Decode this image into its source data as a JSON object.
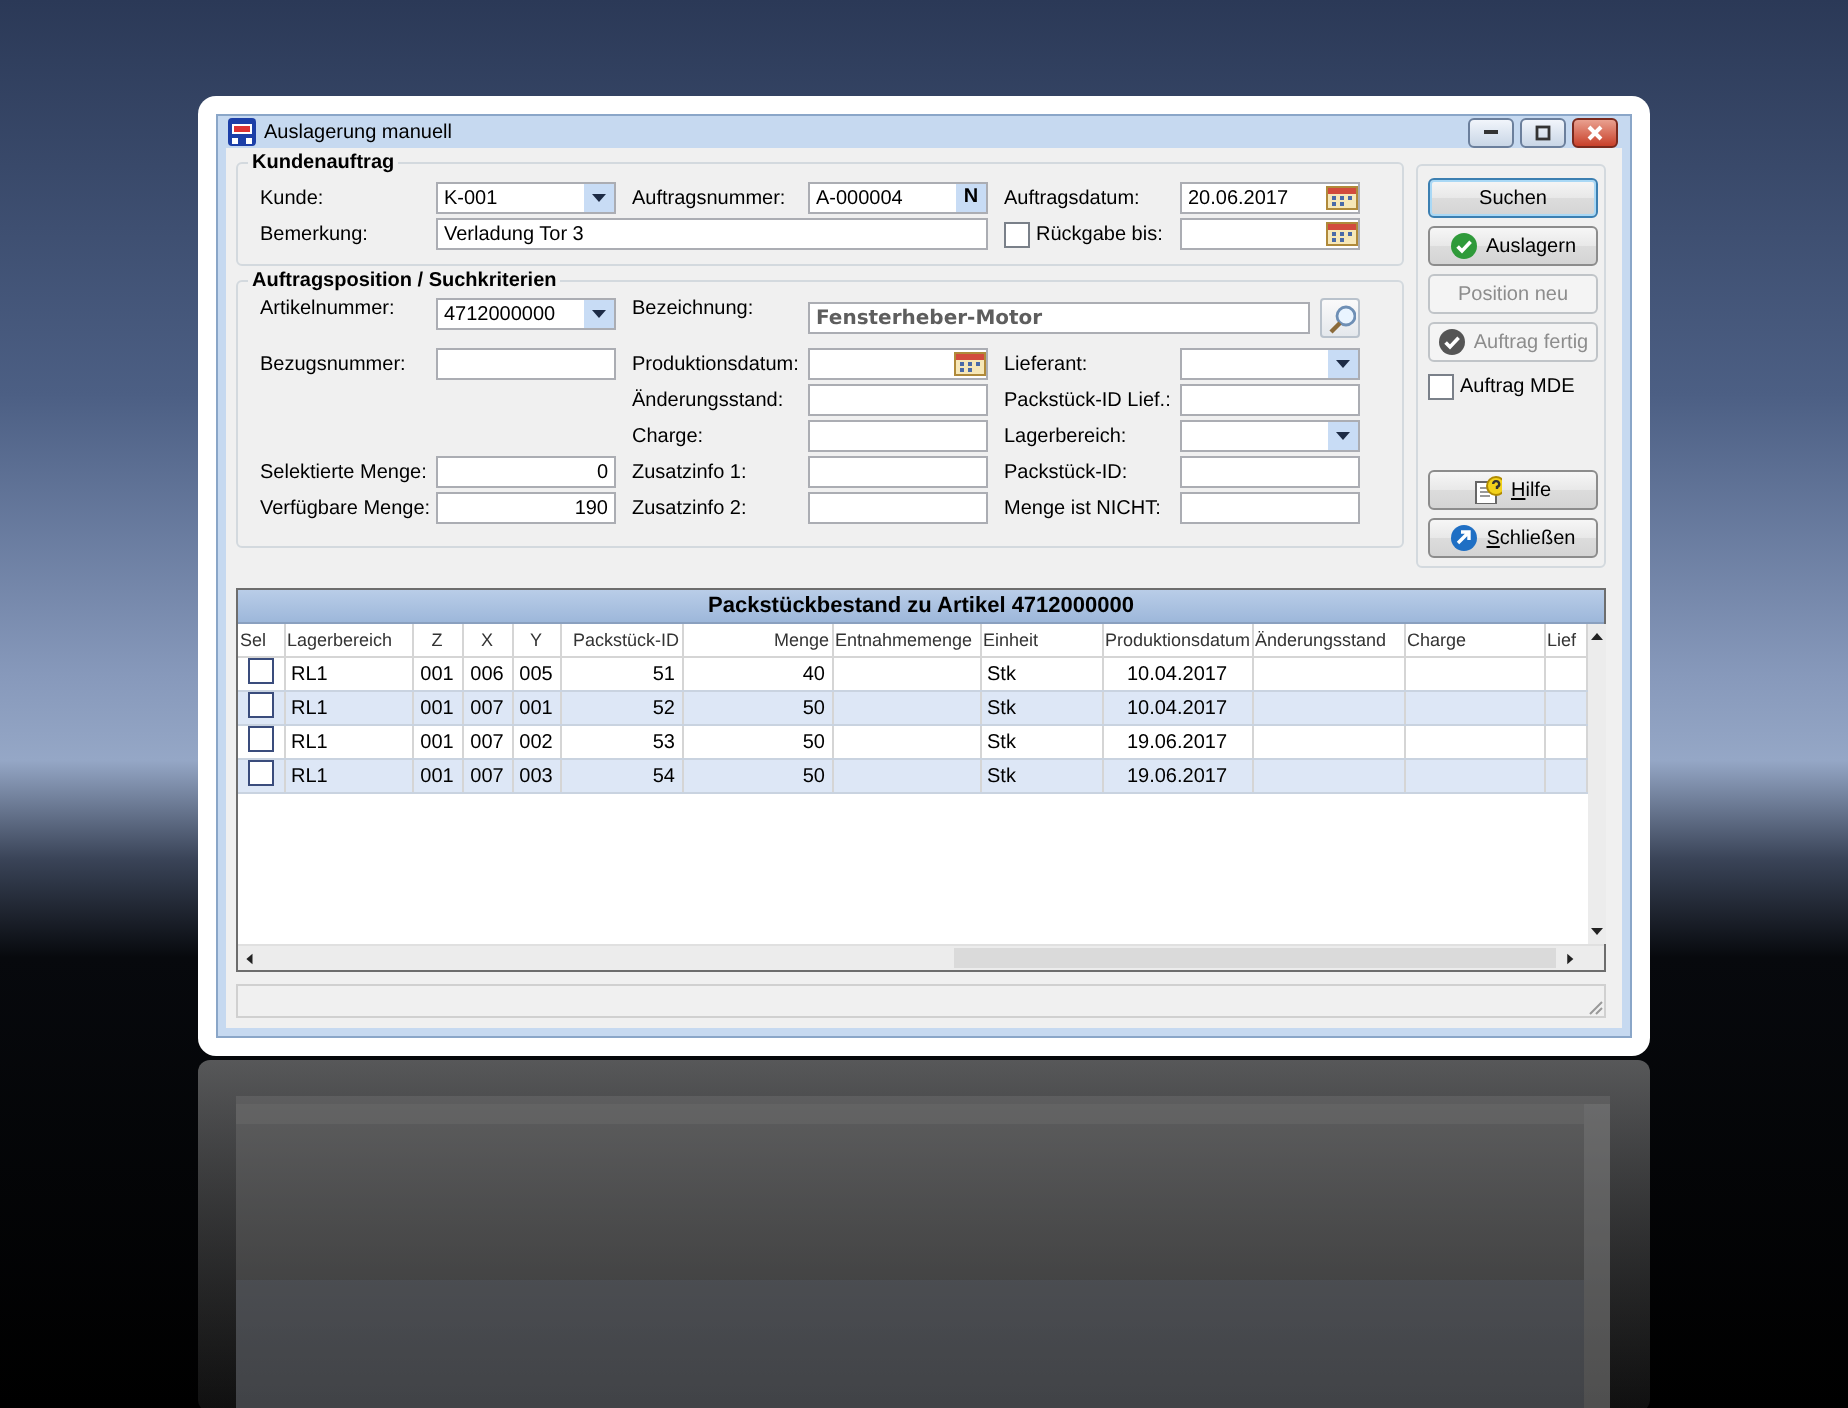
{
  "window": {
    "title": "Auslagerung manuell"
  },
  "customer_order": {
    "title": "Kundenauftrag",
    "customer": {
      "label": "Kunde:",
      "value": "K-001"
    },
    "order_number": {
      "label": "Auftragsnummer:",
      "value": "A-000004",
      "button": "N"
    },
    "order_date": {
      "label": "Auftragsdatum:",
      "value": "20.06.2017"
    },
    "remark": {
      "label": "Bemerkung:",
      "value": "Verladung Tor 3"
    },
    "return_by": {
      "label": "Rückgabe bis:",
      "checked": false
    }
  },
  "position": {
    "title": "Auftragsposition / Suchkriterien",
    "article_number": {
      "label": "Artikelnummer:",
      "value": "4712000000"
    },
    "description": {
      "label": "Bezeichnung:",
      "value": "Fensterheber-Motor"
    },
    "reference_number": {
      "label": "Bezugsnummer:"
    },
    "selected_quantity": {
      "label": "Selektierte Menge:",
      "value": "0"
    },
    "available_quantity": {
      "label": "Verfügbare Menge:",
      "value": "190"
    },
    "production_date": {
      "label": "Produktionsdatum:"
    },
    "change_level": {
      "label": "Änderungsstand:"
    },
    "batch": {
      "label": "Charge:"
    },
    "extra_info_1": {
      "label": "Zusatzinfo 1:"
    },
    "extra_info_2": {
      "label": "Zusatzinfo 2:"
    },
    "supplier": {
      "label": "Lieferant:"
    },
    "supplier_package_id": {
      "label": "Packstück-ID Lief.:"
    },
    "storage_area": {
      "label": "Lagerbereich:"
    },
    "package_id": {
      "label": "Packstück-ID:"
    },
    "quantity_not": {
      "label": "Menge ist NICHT:"
    }
  },
  "actions": [
    {
      "kind": "button",
      "label": "Suchen",
      "default": true,
      "disabled": false,
      "mnemonic": false
    },
    {
      "kind": "button",
      "label": "Auslagern",
      "default": false,
      "disabled": false,
      "mnemonic": false
    },
    {
      "kind": "button",
      "label": "Position neu",
      "default": false,
      "disabled": true,
      "mnemonic": false
    },
    {
      "kind": "button",
      "label": "Auftrag fertig",
      "default": false,
      "disabled": true,
      "mnemonic": false
    },
    {
      "kind": "checkbox",
      "label": "Auftrag MDE",
      "checked": false
    },
    {
      "kind": "button",
      "label": "Hilfe",
      "default": false,
      "disabled": false,
      "mnemonic": true
    },
    {
      "kind": "button",
      "label": "Schließen",
      "default": false,
      "disabled": false,
      "mnemonic": true
    }
  ],
  "table": {
    "title": "Packstückbestand zu Artikel 4712000000",
    "columns": [
      "Sel",
      "Lagerbereich",
      "Z",
      "X",
      "Y",
      "Packstück-ID",
      "Menge",
      "Entnahmemenge",
      "Einheit",
      "Produktionsdatum",
      "Änderungsstand",
      "Charge",
      "Lief"
    ],
    "rows": [
      {
        "checked": false,
        "cells": [
          "",
          "RL1",
          "001",
          "006",
          "005",
          "51",
          "40",
          "",
          "Stk",
          "10.04.2017"
        ]
      },
      {
        "checked": false,
        "cells": [
          "",
          "RL1",
          "001",
          "007",
          "001",
          "52",
          "50",
          "",
          "Stk",
          "10.04.2017"
        ]
      },
      {
        "checked": false,
        "cells": [
          "",
          "RL1",
          "001",
          "007",
          "002",
          "53",
          "50",
          "",
          "Stk",
          "19.06.2017"
        ]
      },
      {
        "checked": false,
        "cells": [
          "",
          "RL1",
          "001",
          "007",
          "003",
          "54",
          "50",
          "",
          "Stk",
          "19.06.2017"
        ]
      }
    ]
  }
}
